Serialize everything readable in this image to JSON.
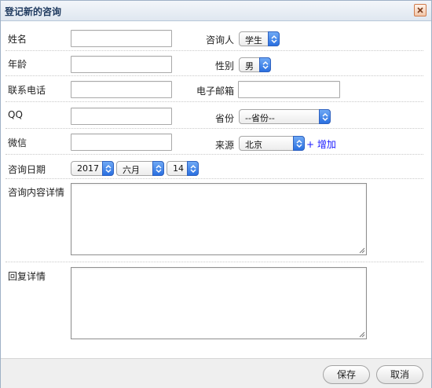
{
  "dialog": {
    "title": "登记新的咨询",
    "close_icon": "close-icon"
  },
  "form": {
    "name_label": "姓名",
    "consultant_label": "咨询人",
    "consultant_value": "学生",
    "age_label": "年龄",
    "gender_label": "性别",
    "gender_value": "男",
    "phone_label": "联系电话",
    "email_label": "电子邮箱",
    "qq_label": "QQ",
    "province_label": "省份",
    "province_value": "--省份--",
    "wechat_label": "微信",
    "source_label": "来源",
    "source_value": "北京",
    "add_link": "+ 增加",
    "date_label": "咨询日期",
    "year_value": "2017",
    "month_value": "六月",
    "day_value": "14",
    "content_label": "咨询内容详情",
    "reply_label": "回复详情"
  },
  "footer": {
    "save_label": "保存",
    "cancel_label": "取消"
  },
  "colors": {
    "select_arrow": "#2a6fe0",
    "link": "#1a1aff",
    "title_text": "#1f3a5f"
  }
}
